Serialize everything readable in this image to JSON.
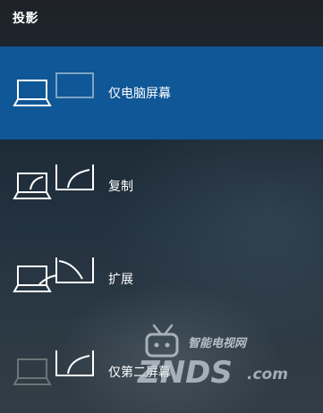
{
  "panel": {
    "title": "投影"
  },
  "options": [
    {
      "label": "仅电脑屏幕",
      "icon": "pc-screen-only-icon",
      "selected": true
    },
    {
      "label": "复制",
      "icon": "duplicate-icon",
      "selected": false
    },
    {
      "label": "扩展",
      "icon": "extend-icon",
      "selected": false
    },
    {
      "label": "仅第二屏幕",
      "icon": "second-screen-only-icon",
      "selected": false
    }
  ],
  "watermark": {
    "top_text": "智能电视网",
    "brand_text": "ZNDS",
    "suffix_text": ".com"
  },
  "colors": {
    "selected_background": "#0f5796",
    "text": "#ffffff",
    "dim_icon": "#6b7478",
    "dim_frame": "#7fa4c4"
  }
}
